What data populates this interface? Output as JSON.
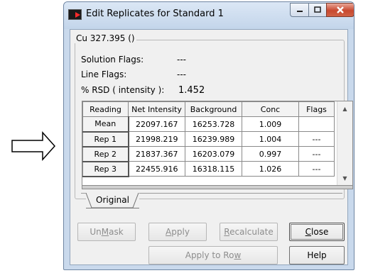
{
  "window": {
    "title": "Edit Replicates for Standard 1"
  },
  "group": {
    "title": "Cu 327.395 ()",
    "solution_flags_label": "Solution Flags:",
    "solution_flags_value": "---",
    "line_flags_label": "Line Flags:",
    "line_flags_value": "---",
    "rsd_label": "% RSD ( intensity ):",
    "rsd_value": "1.452"
  },
  "grid": {
    "columns": [
      "Reading",
      "Net Intensity",
      "Background",
      "Conc",
      "Flags"
    ],
    "rows": [
      [
        "Mean",
        "22097.167",
        "16253.728",
        "1.009",
        ""
      ],
      [
        "Rep 1",
        "21998.219",
        "16239.989",
        "1.004",
        "---"
      ],
      [
        "Rep 2",
        "21837.367",
        "16203.079",
        "0.997",
        "---"
      ],
      [
        "Rep 3",
        "22455.916",
        "16318.115",
        "1.026",
        "---"
      ]
    ]
  },
  "tabs": [
    {
      "label": "Original"
    }
  ],
  "buttons": {
    "unmask": {
      "pre": "Un",
      "accel": "M",
      "post": "ask"
    },
    "apply": {
      "pre": "",
      "accel": "A",
      "post": "pply"
    },
    "recalculate": {
      "pre": "",
      "accel": "R",
      "post": "ecalculate"
    },
    "close": {
      "pre": "",
      "accel": "C",
      "post": "lose"
    },
    "apply_to_row": {
      "pre": "Apply to Ro",
      "accel": "w",
      "post": ""
    },
    "help": {
      "pre": "Help",
      "accel": "",
      "post": ""
    }
  },
  "colors": {
    "title_bar": "#c3d5ea",
    "close_button": "#c8482f",
    "arrow": "#000000"
  },
  "icons": [
    "right-arrow-icon",
    "app-icon",
    "minimize-icon",
    "maximize-icon",
    "close-icon",
    "scroll-up-icon",
    "scroll-down-icon"
  ]
}
